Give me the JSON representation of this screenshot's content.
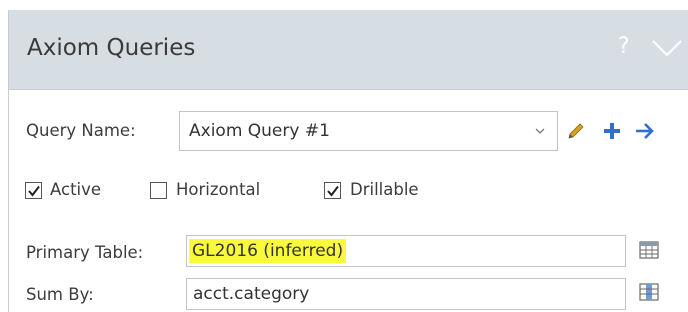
{
  "panel": {
    "title": "Axiom Queries",
    "help_label": "?",
    "collapse_icon": "chevron-down-icon"
  },
  "query_name": {
    "label": "Query Name:",
    "selected_value": "Axiom Query #1",
    "icons": [
      "pencil-icon",
      "plus-icon",
      "arrow-right-icon"
    ]
  },
  "checkboxes": [
    {
      "label": "Active",
      "checked": true
    },
    {
      "label": "Horizontal",
      "checked": false
    },
    {
      "label": "Drillable",
      "checked": true
    }
  ],
  "primary_table": {
    "label": "Primary Table:",
    "value": "GL2016 (inferred)",
    "highlight_color": "#fafa3c",
    "icon": "table-grid-icon"
  },
  "sum_by": {
    "label": "Sum By:",
    "value": "acct.category",
    "icon": "columns-icon"
  },
  "colors": {
    "header_bg": "#d6dde3",
    "accent_blue": "#2f6fd1",
    "pencil": "#d6a020"
  }
}
